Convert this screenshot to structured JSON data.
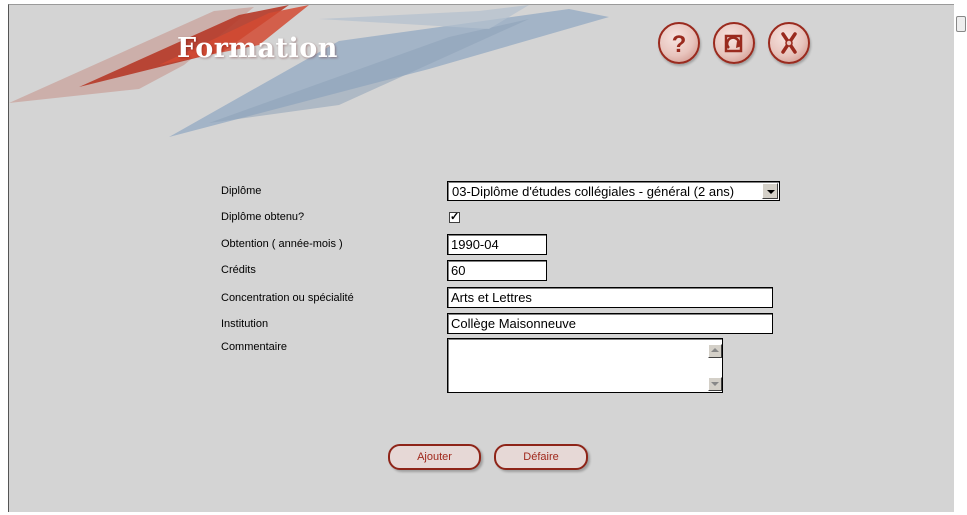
{
  "header": {
    "title": "Formation",
    "icons": [
      "help-icon",
      "refresh-icon",
      "close-icon"
    ]
  },
  "form": {
    "diplome_label": "Diplôme",
    "diplome_value": "03-Diplôme d'études collégiales - général (2 ans)",
    "diplome_obtenu_label": "Diplôme obtenu?",
    "diplome_obtenu_checked": true,
    "check_mark": "✓",
    "obtention_label": "Obtention ( année-mois )",
    "obtention_value": "1990-04",
    "credits_label": "Crédits",
    "credits_value": "60",
    "concentration_label": "Concentration ou spécialité",
    "concentration_value": "Arts et Lettres",
    "institution_label": "Institution",
    "institution_value": "Collège Maisonneuve",
    "commentaire_label": "Commentaire",
    "commentaire_value": ""
  },
  "buttons": {
    "ajouter": "Ajouter",
    "defaire": "Défaire"
  },
  "colors": {
    "background": "#d4d4d4",
    "accent_red": "#9a2a1e",
    "banner_blue": "#9aaec4"
  }
}
